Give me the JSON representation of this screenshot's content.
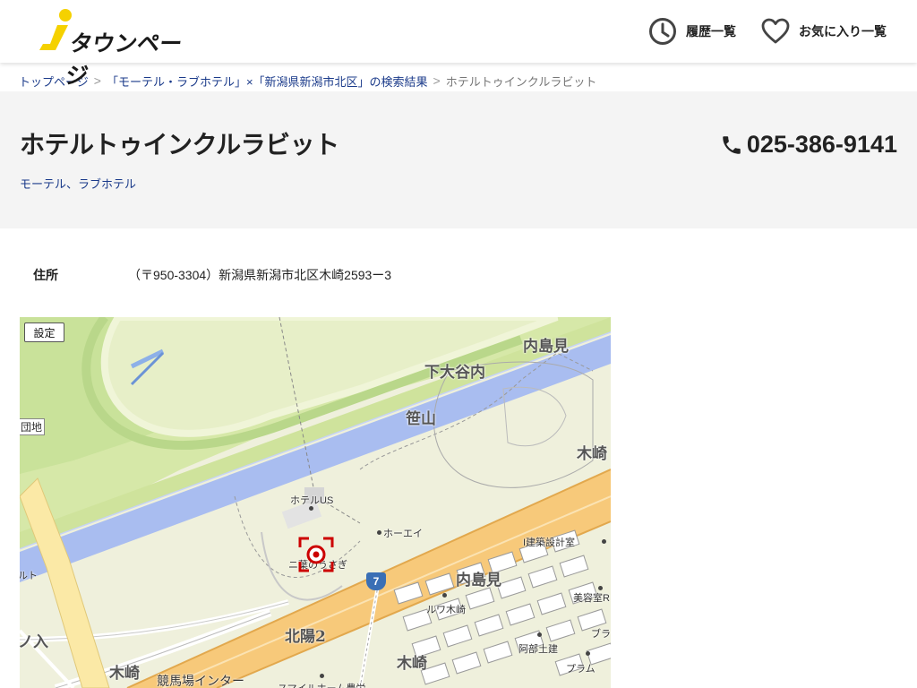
{
  "header": {
    "logo_text": "タウンページ",
    "history_label": "履歴一覧",
    "favorites_label": "お気に入り一覧"
  },
  "breadcrumb": {
    "items": [
      "トップページ",
      "「モーテル・ラブホテル」×「新潟県新潟市北区」の検索結果",
      "ホテルトゥインクルラビット"
    ],
    "separator": ">"
  },
  "shop": {
    "name": "ホテルトゥインクルラビット",
    "category": "モーテル、ラブホテル",
    "phone": "025-386-9141"
  },
  "address": {
    "label": "住所",
    "value": "（〒950-3304）新潟県新潟市北区木崎2593ー3"
  },
  "map": {
    "setting_button": "設定",
    "route_number": "7",
    "place_labels": {
      "uchijimami_top": "内島見",
      "shimoodaiyachi": "下大谷内",
      "sasayama": "笹山",
      "kizaki_right": "木崎",
      "danchi": "団地",
      "hotel_us": "ホテルUS",
      "hoei": "ホーエイ",
      "kenchiku": "I建築設計室",
      "shop_near": "ニ葉のうさぎ",
      "uchijimami_bottom": "内島見",
      "biyoushitsu": "美容室R",
      "ruwa": "ルワ木崎",
      "abe": "阿部土建",
      "fura": "ブラ",
      "puramu": "プラム",
      "left_edge": "ルト",
      "nonoiri": "ノ入",
      "hokuyo": "北陽2",
      "kizaki_bottom_left": "木崎",
      "kizaki_bottom_mid": "木崎",
      "keibajo": "競馬場インター",
      "smile": "スマイルホーム豊栄"
    }
  },
  "colors": {
    "link": "#1a3a8a",
    "title_band": "#f4f4f4",
    "map_base": "#eff0dc",
    "river": "#a9bdf0",
    "highway": "#f7c97a",
    "green": "#c9e29a",
    "marker": "#cc0000"
  }
}
